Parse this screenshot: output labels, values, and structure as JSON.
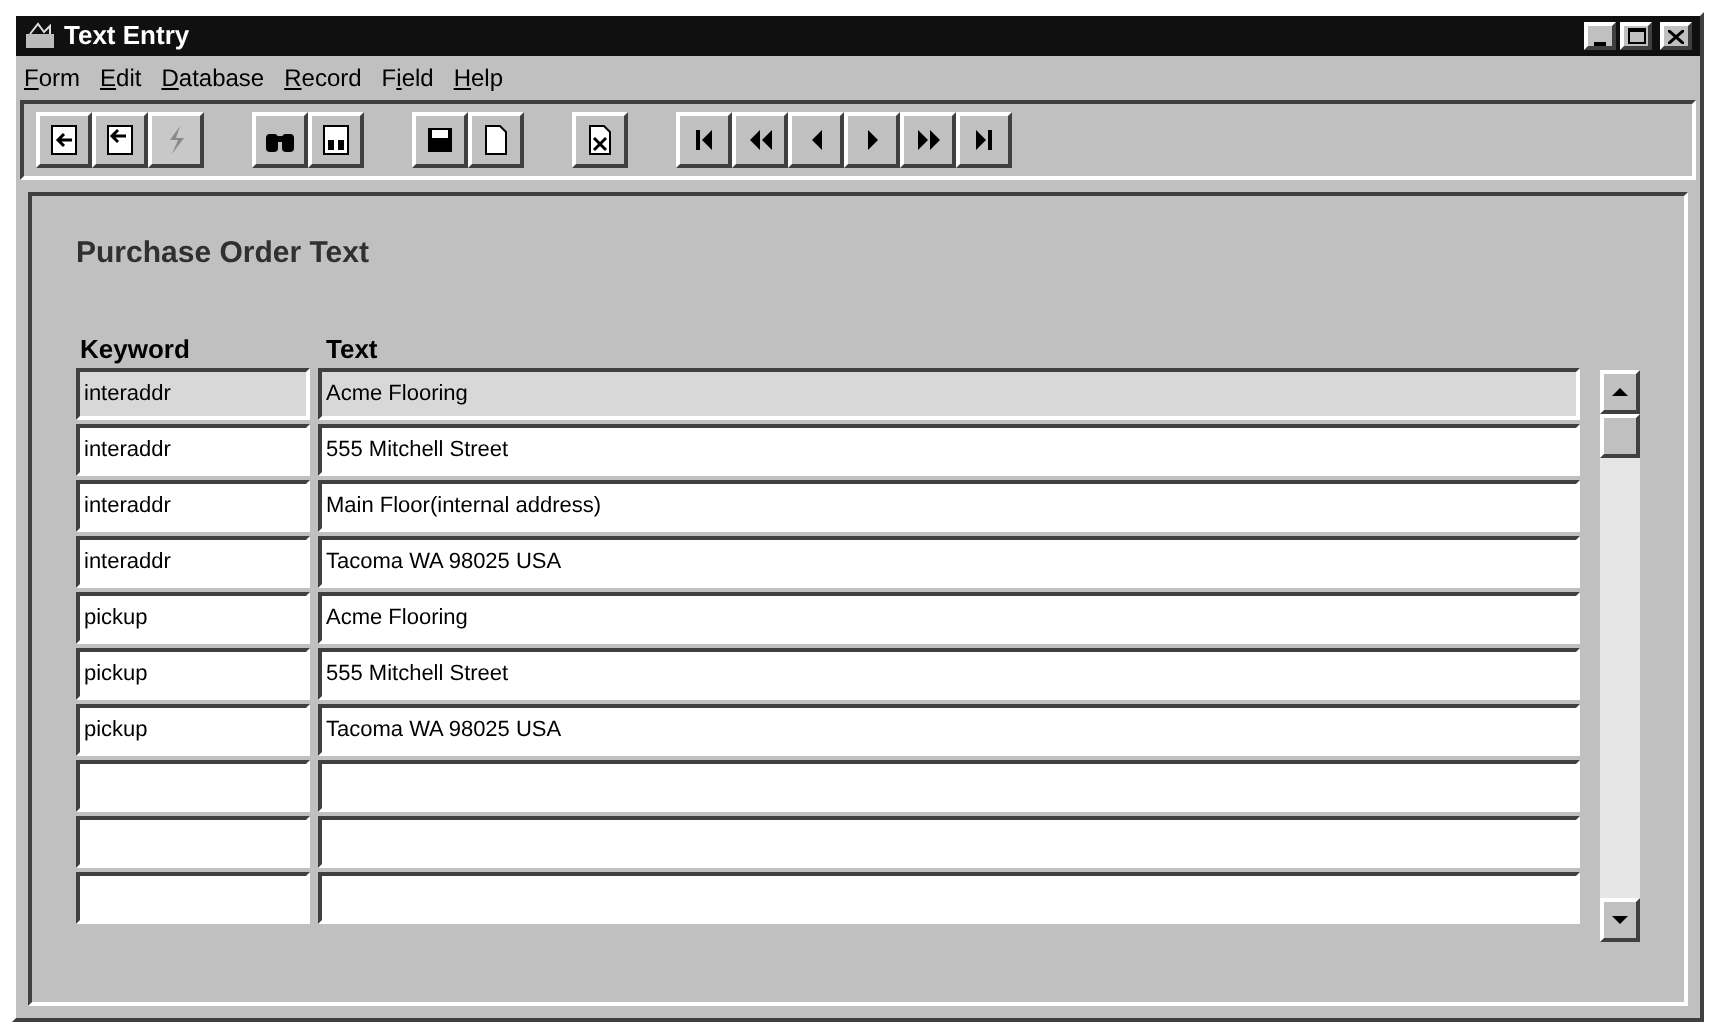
{
  "window": {
    "title": "Text Entry"
  },
  "menu": [
    {
      "key": "F",
      "rest": "orm"
    },
    {
      "key": "E",
      "rest": "dit"
    },
    {
      "key": "D",
      "rest": "atabase"
    },
    {
      "key": "R",
      "rest": "ecord"
    },
    {
      "lead": "F",
      "key": "i",
      "rest": "eld"
    },
    {
      "key": "H",
      "rest": "elp"
    }
  ],
  "toolbar": {
    "groups": [
      [
        {
          "kind": "accept",
          "disabled": false
        },
        {
          "kind": "revert",
          "disabled": false
        },
        {
          "kind": "execute",
          "disabled": true
        }
      ],
      [
        {
          "kind": "find",
          "disabled": false
        },
        {
          "kind": "find-form",
          "disabled": false
        }
      ],
      [
        {
          "kind": "save",
          "disabled": false
        },
        {
          "kind": "new",
          "disabled": false
        }
      ],
      [
        {
          "kind": "delete",
          "disabled": false
        }
      ],
      [
        {
          "kind": "first",
          "disabled": false
        },
        {
          "kind": "prev-page",
          "disabled": false
        },
        {
          "kind": "prev",
          "disabled": false
        },
        {
          "kind": "next",
          "disabled": false
        },
        {
          "kind": "next-page",
          "disabled": false
        },
        {
          "kind": "last",
          "disabled": false
        }
      ]
    ]
  },
  "form": {
    "title": "Purchase Order Text",
    "columns": [
      "Keyword",
      "Text"
    ],
    "rows": [
      {
        "keyword": "interaddr",
        "text": "Acme Flooring",
        "selected": true
      },
      {
        "keyword": "interaddr",
        "text": "555 Mitchell Street",
        "selected": false
      },
      {
        "keyword": "interaddr",
        "text": "Main Floor(internal address)",
        "selected": false
      },
      {
        "keyword": "interaddr",
        "text": "Tacoma WA 98025 USA",
        "selected": false
      },
      {
        "keyword": "pickup",
        "text": "Acme Flooring",
        "selected": false
      },
      {
        "keyword": "pickup",
        "text": "555 Mitchell Street",
        "selected": false
      },
      {
        "keyword": "pickup",
        "text": "Tacoma WA 98025 USA",
        "selected": false
      }
    ]
  }
}
